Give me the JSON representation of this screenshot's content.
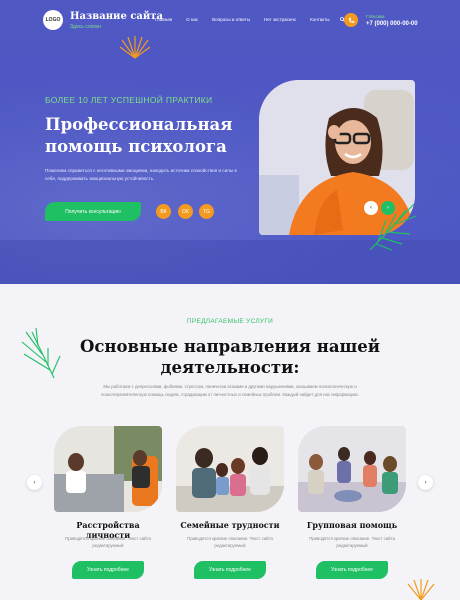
{
  "header": {
    "logo": "LOGO",
    "site_title": "Название сайта",
    "site_subtitle": "Здесь слоган",
    "nav": [
      "Главная",
      "О нас",
      "Вопросы и ответы",
      "Нет экстрасенс",
      "Контакты"
    ],
    "city": "Г.Москва",
    "phone": "+7 (000) 000-00-00"
  },
  "hero": {
    "tagline": "БОЛЕЕ 10 ЛЕТ УСПЕШНОЙ ПРАКТИКИ",
    "title": "Профессиональная помощь психолога",
    "text": "Помогаем справиться с негативными эмоциями, находить источник спокойствия и силы в себе, поддерживать эмоциональную устойчивость.",
    "cta": "Получить консультацию",
    "social": [
      "ВК",
      "ОК",
      "TG"
    ]
  },
  "services": {
    "tag": "ПРЕДЛАГАЕМЫЕ УСЛУГИ",
    "title": "Основные направления нашей деятельности:",
    "description": "Мы работаем с депрессиями, фобиями, стрессом, панически атаками и другими нарушениями, оказываем психологическую и психотерапевтическую помощь людям, страдающим от личностных и семейных проблем. Каждый найдет для нас информацию.",
    "cards": [
      {
        "title": "Расстройства личности",
        "text": "Приводятся краткие описание. Текст сайта редактируемый",
        "button": "Узнать подробнее"
      },
      {
        "title": "Семейные трудности",
        "text": "Приводятся краткие описание. Текст сайта редактируемый",
        "button": "Узнать подробнее"
      },
      {
        "title": "Групповая помощь",
        "text": "Приводятся краткие описание. Текст сайта редактируемый",
        "button": "Узнать подробнее"
      }
    ]
  },
  "colors": {
    "primary": "#4d56c4",
    "accent_green": "#1fbf63",
    "accent_orange": "#f39a20"
  },
  "icons": [
    "search-icon",
    "phone-icon",
    "vk-icon",
    "ok-icon",
    "telegram-icon",
    "arrow-left-icon",
    "arrow-right-icon",
    "palm-leaf-icon"
  ]
}
